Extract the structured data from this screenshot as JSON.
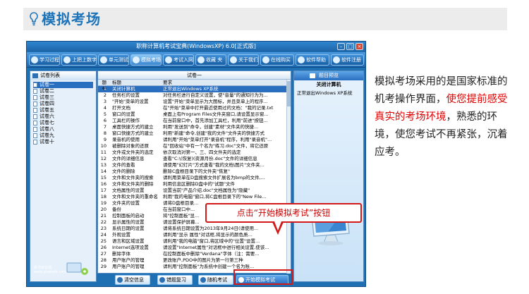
{
  "header": {
    "title": "模拟考场",
    "icon": "lightbulb-icon",
    "accent": "#1c73b9"
  },
  "window": {
    "title": "职称计算机考试宝典(WindowsXP) 6.0[正式版]",
    "toolbar": [
      "学习过程",
      "上把上数字",
      "单元测试",
      "模拟考场",
      "考试入网",
      "收藏 夹",
      "关于我们",
      "在线购买",
      "软件帮助",
      "软件注册"
    ],
    "left_panel": {
      "header": "试卷列表",
      "items": [
        "试卷一",
        "试卷二",
        "试卷三",
        "试卷四",
        "试卷五",
        "试卷六",
        "试卷七",
        "试卷八",
        "试卷九",
        "试卷十"
      ],
      "brand": "新书目在线\nwww.ytxpsoft.com"
    },
    "question_panel": {
      "title": "试卷一",
      "headers": [
        "题号",
        "标题",
        "要求"
      ],
      "rows": [
        [
          "1",
          "关闭计算机",
          "正常退出Windows XP系统"
        ],
        [
          "2",
          "任务栏的设置",
          "对任务栏进行自定义设置，使\"音量\"的通知行为为..."
        ],
        [
          "3",
          "\"开始\"菜单的设置",
          "设置\"开始\"菜单显示为大图标，并且菜单上的程序..."
        ],
        [
          "4",
          "打开文档",
          "在\"开始\"菜单中打开最近使用过的文档：\"我的记录.txt"
        ],
        [
          "5",
          "窗口的设置",
          "桌面上有Program Files文件夹窗口,请设置显示窗..."
        ],
        [
          "6",
          "工具栏的操作",
          "在当前窗口中，首先添加工具栏，利用\"前进\"按钮..."
        ],
        [
          "7",
          "桌面快捷方式的建立",
          "利用\"发送到\"命令，创建\"素材\"文件夹的快捷..."
        ],
        [
          "8",
          "窗口快捷方式的建立",
          "利用\"新建\"命令,创建\"我的文件\"文件夹的快捷方式"
        ],
        [
          "9",
          "录音机的使用",
          "请利用\"开始\"菜单打开\"录音机\"程序，利用\"录音机\"..."
        ],
        [
          "10",
          "被删除对象的还原",
          "在\"回收站\"中有一个名为\"练习.doc\"文件，将它还原"
        ],
        [
          "11",
          "文件或文件夹的选定",
          "依次取消对第一、三、四文件夹的选定"
        ],
        [
          "12",
          "文件的详细信息",
          "查看\"C:\\(恢复)(资源月份.doc\"文件的详细信息"
        ],
        [
          "13",
          "文件的查看",
          "请使用\"幻灯片\"方式查看\"我的文档\\图片\"文件夹..."
        ],
        [
          "14",
          "文件的删除",
          "删除C盘根目录下的文件夹\"恢复\""
        ],
        [
          "15",
          "文件和文件夹的搜索",
          "请利用菜单在D盘搜索文件扩展名为bmp的文件,..."
        ],
        [
          "16",
          "文件和文件夹的删除",
          "利用信息区删除D盘中的\"试题\"文件"
        ],
        [
          "17",
          "文档属性的设置",
          "设置当前\"产品介绍.doc\"文档属性为\"隐藏\""
        ],
        [
          "18",
          "文件和文件夹的重命名",
          "利用\"我的电脑\"窗口,将C盘根目录下的\"New File..."
        ],
        [
          "19",
          "文件夹的设置",
          "请将D盘根目录..."
        ],
        [
          "20",
          "备份",
          "在当前窗口中..."
        ],
        [
          "21",
          "控制面板的启动",
          "将\"控制面板\"显..."
        ],
        [
          "22",
          "显示属性的设置",
          "请设置保护屏幕..."
        ],
        [
          "23",
          "系统日期的设置",
          "请将系统日期设置为2013年9月24日(请使用..."
        ],
        [
          "24",
          "外观设置",
          "请利用\"显示 属性\"对话框,将显示的颜色质..."
        ],
        [
          "25",
          "语言和区域设置",
          "请利用\"我的电脑\"窗口,将区域中的\"位置\"设置..."
        ],
        [
          "26",
          "Internet选项设置",
          "请设置\"Internet属性\"对话框中进行相关设置,使该..."
        ],
        [
          "27",
          "删除字体",
          "在控制面板中删除\"Verdana\"字体（注：需要..."
        ],
        [
          "28",
          "用户账户的管理",
          "更改账户,PDO中的图片为第一行第三种"
        ],
        [
          "29",
          "用户账户的管理",
          "请利用\"控制面板\"为系统中创建一个名为账..."
        ]
      ]
    },
    "info_panel": {
      "header": "题目预览",
      "subtitle": "关闭计算机",
      "description": "正常退出Windows XP系统"
    },
    "bottom_buttons": [
      "清空信息",
      "错题复习",
      "随机考试",
      "开始模拟考试"
    ]
  },
  "callout": {
    "text": "点击“开始模拟考试”按钮",
    "color": "#d21a1a"
  },
  "side_text": {
    "part1": "模拟考场采用的是国家标准的机考操作界面，",
    "highlight": "使您提前感受真实的考场环境",
    "part2": "，熟悉的环境，使您考试不再紧张，沉着应考。",
    "highlight_color": "#e00000"
  }
}
